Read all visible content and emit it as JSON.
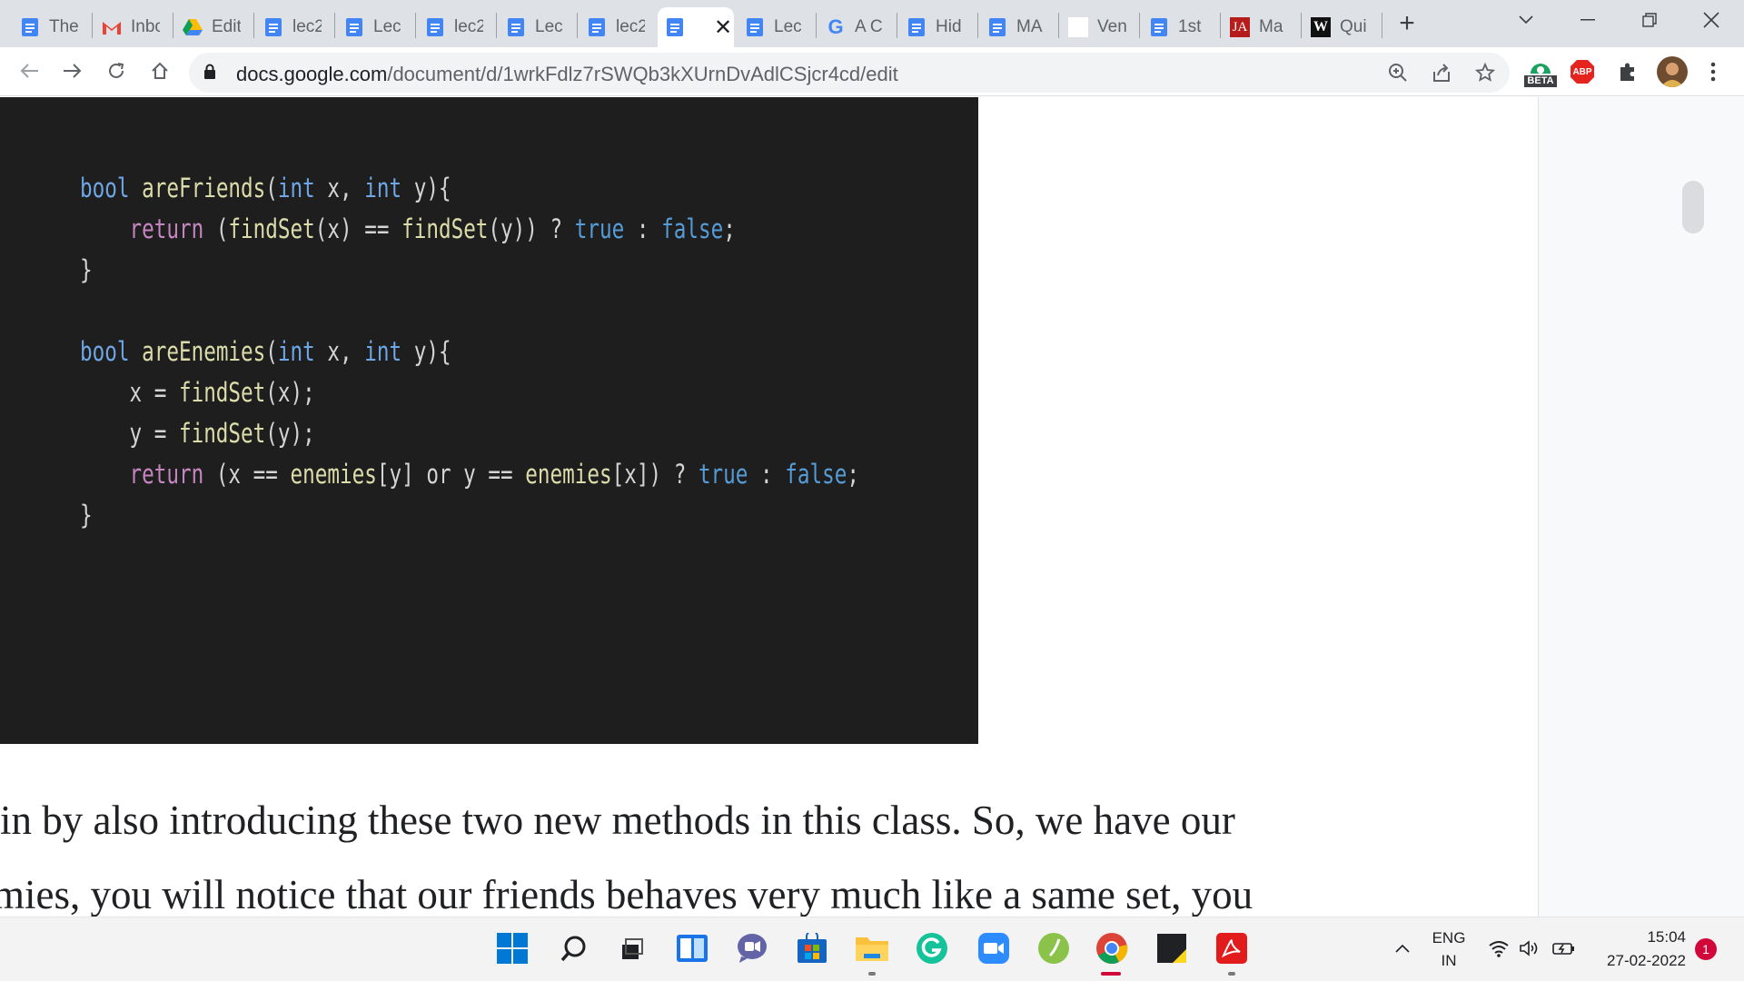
{
  "browser": {
    "tabs": [
      {
        "title": "The",
        "icon": "docs-icon"
      },
      {
        "title": "Inbo",
        "icon": "gmail-icon"
      },
      {
        "title": "Edit",
        "icon": "drive-icon"
      },
      {
        "title": "lec2",
        "icon": "docs-icon"
      },
      {
        "title": "Lec",
        "icon": "docs-icon"
      },
      {
        "title": "lec2",
        "icon": "docs-icon"
      },
      {
        "title": "Lec",
        "icon": "docs-icon"
      },
      {
        "title": "lec2",
        "icon": "docs-icon"
      },
      {
        "title": "",
        "icon": "docs-icon",
        "active": true
      },
      {
        "title": "Lec",
        "icon": "docs-icon"
      },
      {
        "title": "A C",
        "icon": "google-icon"
      },
      {
        "title": "Hid",
        "icon": "docs-icon"
      },
      {
        "title": "MA",
        "icon": "docs-icon"
      },
      {
        "title": "Ven",
        "icon": "blank-page-icon"
      },
      {
        "title": "1st",
        "icon": "docs-icon"
      },
      {
        "title": "Ma",
        "icon": "ja-icon",
        "icon_text": "JA"
      },
      {
        "title": "Qui",
        "icon": "w-icon",
        "icon_text": "W"
      }
    ],
    "new_tab_symbol": "+",
    "url_domain": "docs.google.com",
    "url_path": "/document/d/1wrkFdlz7rSWQb3kXUrnDvAdlCSjcr4cd/edit",
    "extensions": {
      "beta_label": "BETA",
      "abp_label": "ABP"
    }
  },
  "document": {
    "code_lines": [
      "bool areFriends(int x, int y){",
      "    return (findSet(x) == findSet(y)) ? true : false;",
      "}",
      "",
      "bool areEnemies(int x, int y){",
      "    x = findSet(x);",
      "    y = findSet(y);",
      "    return (x == enemies[y] or y == enemies[x]) ? true : false;",
      "}"
    ],
    "text_line_1": "in by also introducing these two new methods in this class. So, we have our",
    "text_line_2": "mies, you will notice that our friends behaves very much like a same set, you"
  },
  "taskbar": {
    "language_top": "ENG",
    "language_bottom": "IN",
    "time": "15:04",
    "date": "27-02-2022",
    "notification_count": "1"
  },
  "colors": {
    "code_bg": "#1e1e1e",
    "keyword": "#6fa6e6",
    "function": "#dcdcaa",
    "control": "#c586c0"
  }
}
